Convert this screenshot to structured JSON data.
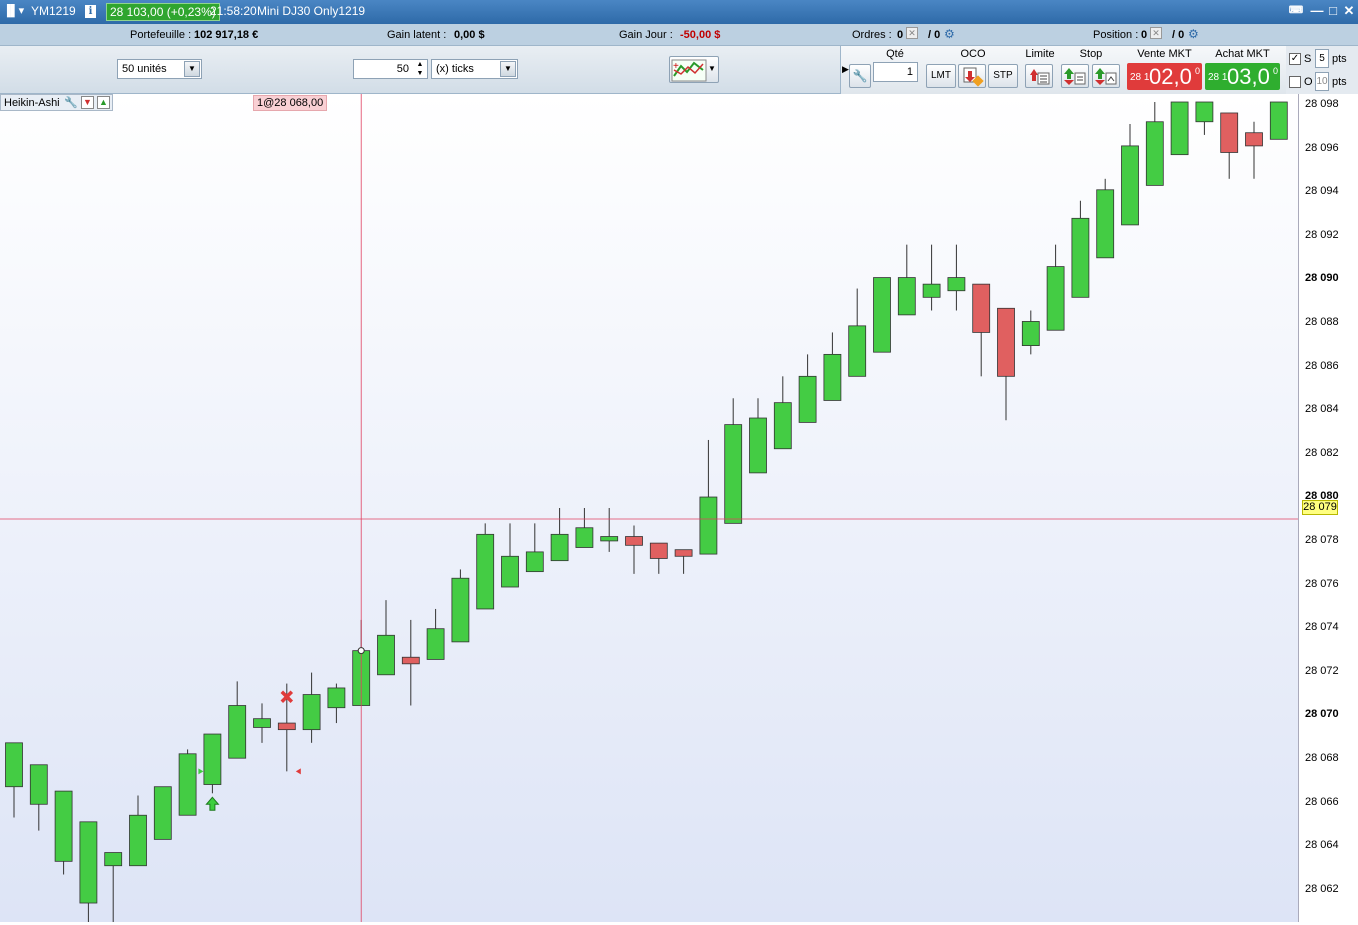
{
  "window": {
    "instrument": "YM1219",
    "price_badge": "28 103,00 (+0,23%)",
    "time": "21:58:20",
    "name": "Mini DJ30 Only1219"
  },
  "infobar": {
    "portefeuille_label": "Portefeuille :",
    "portefeuille_value": "102 917,18 €",
    "gain_latent_label": "Gain latent :",
    "gain_latent_value": "0,00 $",
    "gain_jour_label": "Gain Jour :",
    "gain_jour_value": "-50,00 $",
    "ordres_label": "Ordres :",
    "ordres_value": "0",
    "ordres_value2": "/ 0",
    "position_label": "Position :",
    "position_value": "0",
    "position_value2": "/ 0"
  },
  "toolbar": {
    "units_select": "50 unités",
    "ticks_value": "50",
    "ticks_select": "(x) ticks"
  },
  "tradepanel": {
    "qty_label": "Qté",
    "qty_value": "1",
    "oco_label": "OCO",
    "limite_label": "Limite",
    "stop_label": "Stop",
    "vente_label": "Vente MKT",
    "achat_label": "Achat MKT",
    "lmt_button": "LMT",
    "stp_button": "STP",
    "vente_small": "28 1",
    "vente_big": "02,0",
    "vente_sup": "0",
    "achat_small": "28 1",
    "achat_big": "03,0",
    "achat_sup": "0",
    "s_label": "S",
    "s_value": "5",
    "pts_label": "pts",
    "o_label": "O",
    "o_value": "10",
    "pts_label2": "pts"
  },
  "chart": {
    "indicator_label": "Heikin-Ashi",
    "order_label": "1@28 068,00",
    "cursor_price": "28 079",
    "y_labels": [
      {
        "text": "28 098",
        "bold": false
      },
      {
        "text": "28 096",
        "bold": false
      },
      {
        "text": "28 094",
        "bold": false
      },
      {
        "text": "28 092",
        "bold": false
      },
      {
        "text": "28 090",
        "bold": true
      },
      {
        "text": "28 088",
        "bold": false
      },
      {
        "text": "28 086",
        "bold": false
      },
      {
        "text": "28 084",
        "bold": false
      },
      {
        "text": "28 082",
        "bold": false
      },
      {
        "text": "28 080",
        "bold": true
      },
      {
        "text": "28 078",
        "bold": false
      },
      {
        "text": "28 076",
        "bold": false
      },
      {
        "text": "28 074",
        "bold": false
      },
      {
        "text": "28 072",
        "bold": false
      },
      {
        "text": "28 070",
        "bold": true
      },
      {
        "text": "28 068",
        "bold": false
      },
      {
        "text": "28 066",
        "bold": false
      },
      {
        "text": "28 064",
        "bold": false
      },
      {
        "text": "28 062",
        "bold": false
      }
    ],
    "colors": {
      "up": "#44cc44",
      "down": "#e06060",
      "crosshair": "#e04060"
    }
  },
  "chart_data": {
    "type": "candlestick",
    "ylim": [
      28061.5,
      28098.5
    ],
    "cursor": {
      "bar": 14,
      "price": 28079.5
    },
    "candles": [
      {
        "o": 28067.3,
        "h": 28069.3,
        "l": 28065.9,
        "c": 28069.3
      },
      {
        "o": 28066.5,
        "h": 28068.3,
        "l": 28065.3,
        "c": 28068.3
      },
      {
        "o": 28063.9,
        "h": 28067.1,
        "l": 28063.3,
        "c": 28067.1
      },
      {
        "o": 28062.0,
        "h": 28065.7,
        "l": 28061.1,
        "c": 28065.7
      },
      {
        "o": 28063.7,
        "h": 28064.3,
        "l": 28061.1,
        "c": 28064.3
      },
      {
        "o": 28063.7,
        "h": 28066.9,
        "l": 28063.7,
        "c": 28066.0
      },
      {
        "o": 28064.9,
        "h": 28067.3,
        "l": 28064.9,
        "c": 28067.3
      },
      {
        "o": 28066.0,
        "h": 28069.0,
        "l": 28066.0,
        "c": 28068.8
      },
      {
        "o": 28067.4,
        "h": 28069.5,
        "l": 28067.0,
        "c": 28069.7
      },
      {
        "o": 28068.6,
        "h": 28072.1,
        "l": 28068.6,
        "c": 28071.0
      },
      {
        "o": 28070.0,
        "h": 28071.1,
        "l": 28069.3,
        "c": 28070.4
      },
      {
        "o": 28070.2,
        "h": 28072.0,
        "l": 28068.0,
        "c": 28069.9
      },
      {
        "o": 28069.9,
        "h": 28072.5,
        "l": 28069.3,
        "c": 28071.5
      },
      {
        "o": 28070.9,
        "h": 28072.0,
        "l": 28070.2,
        "c": 28071.8
      },
      {
        "o": 28071.0,
        "h": 28074.9,
        "l": 28071.0,
        "c": 28073.5
      },
      {
        "o": 28072.4,
        "h": 28075.8,
        "l": 28072.4,
        "c": 28074.2
      },
      {
        "o": 28073.2,
        "h": 28074.9,
        "l": 28071.0,
        "c": 28072.9
      },
      {
        "o": 28073.1,
        "h": 28075.4,
        "l": 28073.1,
        "c": 28074.5
      },
      {
        "o": 28073.9,
        "h": 28077.2,
        "l": 28073.9,
        "c": 28076.8
      },
      {
        "o": 28075.4,
        "h": 28079.3,
        "l": 28075.4,
        "c": 28078.8
      },
      {
        "o": 28076.4,
        "h": 28079.3,
        "l": 28076.4,
        "c": 28077.8
      },
      {
        "o": 28077.1,
        "h": 28079.3,
        "l": 28077.1,
        "c": 28078.0
      },
      {
        "o": 28077.6,
        "h": 28080.0,
        "l": 28077.6,
        "c": 28078.8
      },
      {
        "o": 28078.2,
        "h": 28080.0,
        "l": 28078.2,
        "c": 28079.1
      },
      {
        "o": 28078.5,
        "h": 28080.0,
        "l": 28078.0,
        "c": 28078.7
      },
      {
        "o": 28078.7,
        "h": 28079.2,
        "l": 28077.0,
        "c": 28078.3
      },
      {
        "o": 28078.4,
        "h": 28078.4,
        "l": 28077.0,
        "c": 28077.7
      },
      {
        "o": 28078.1,
        "h": 28078.1,
        "l": 28077.0,
        "c": 28077.8
      },
      {
        "o": 28077.9,
        "h": 28083.1,
        "l": 28077.9,
        "c": 28080.5
      },
      {
        "o": 28079.3,
        "h": 28085.0,
        "l": 28079.3,
        "c": 28083.8
      },
      {
        "o": 28081.6,
        "h": 28085.0,
        "l": 28081.6,
        "c": 28084.1
      },
      {
        "o": 28082.7,
        "h": 28086.0,
        "l": 28082.7,
        "c": 28084.8
      },
      {
        "o": 28083.9,
        "h": 28087.0,
        "l": 28083.9,
        "c": 28086.0
      },
      {
        "o": 28084.9,
        "h": 28088.0,
        "l": 28084.9,
        "c": 28087.0
      },
      {
        "o": 28086.0,
        "h": 28090.0,
        "l": 28086.0,
        "c": 28088.3
      },
      {
        "o": 28087.1,
        "h": 28090.5,
        "l": 28087.1,
        "c": 28090.5
      },
      {
        "o": 28088.8,
        "h": 28092.0,
        "l": 28088.8,
        "c": 28090.5
      },
      {
        "o": 28089.6,
        "h": 28092.0,
        "l": 28089.0,
        "c": 28090.2
      },
      {
        "o": 28089.9,
        "h": 28092.0,
        "l": 28089.0,
        "c": 28090.5
      },
      {
        "o": 28090.2,
        "h": 28090.2,
        "l": 28086.0,
        "c": 28088.0
      },
      {
        "o": 28089.1,
        "h": 28089.1,
        "l": 28084.0,
        "c": 28086.0
      },
      {
        "o": 28087.4,
        "h": 28089.0,
        "l": 28087.0,
        "c": 28088.5
      },
      {
        "o": 28088.1,
        "h": 28092.0,
        "l": 28088.1,
        "c": 28091.0
      },
      {
        "o": 28089.6,
        "h": 28094.0,
        "l": 28089.6,
        "c": 28093.2
      },
      {
        "o": 28091.4,
        "h": 28095.0,
        "l": 28091.4,
        "c": 28094.5
      },
      {
        "o": 28092.9,
        "h": 28097.5,
        "l": 28092.9,
        "c": 28096.5
      },
      {
        "o": 28094.7,
        "h": 28098.5,
        "l": 28094.7,
        "c": 28097.6
      },
      {
        "o": 28096.1,
        "h": 28098.5,
        "l": 28096.1,
        "c": 28098.5
      },
      {
        "o": 28097.6,
        "h": 28098.5,
        "l": 28097.0,
        "c": 28098.5
      },
      {
        "o": 28098.0,
        "h": 28098.0,
        "l": 28095.0,
        "c": 28096.2
      },
      {
        "o": 28097.1,
        "h": 28097.6,
        "l": 28095.0,
        "c": 28096.5
      },
      {
        "o": 28096.8,
        "h": 28098.5,
        "l": 28096.8,
        "c": 28098.5
      }
    ],
    "markers": [
      {
        "type": "buy-arrow",
        "bar": 8,
        "price": 28066.5
      },
      {
        "type": "sell-cross",
        "bar": 11,
        "price": 28071.4
      },
      {
        "type": "entry-triangle",
        "bar": 8,
        "price": 28068.0
      },
      {
        "type": "exit-triangle",
        "bar": 11,
        "price": 28068.0
      }
    ]
  }
}
